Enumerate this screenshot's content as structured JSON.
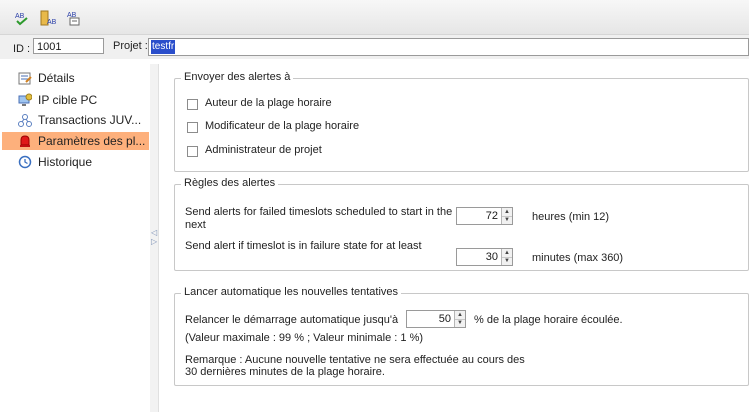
{
  "toolbar": {
    "buttons": [
      {
        "icon": "spellcheck-icon",
        "label": "AB"
      },
      {
        "icon": "rename-icon",
        "label": "AB"
      },
      {
        "icon": "paste-text-icon",
        "label": "AB"
      }
    ]
  },
  "header": {
    "id_label": "ID :",
    "id_value": "1001",
    "project_label": "Projet :",
    "project_value": "testfr"
  },
  "sidebar": {
    "items": [
      {
        "label": "Détails",
        "icon": "details-icon",
        "selected": false
      },
      {
        "label": "IP cible PC",
        "icon": "target-ip-icon",
        "selected": false
      },
      {
        "label": "Transactions JUV...",
        "icon": "transactions-icon",
        "selected": false
      },
      {
        "label": "Paramètres des pl...",
        "icon": "alert-bell-icon",
        "selected": true
      },
      {
        "label": "Historique",
        "icon": "history-icon",
        "selected": false
      }
    ]
  },
  "splitter": {
    "left_arrow": "◁",
    "right_arrow": "▷"
  },
  "alerts_to": {
    "title": "Envoyer des alertes à",
    "options": [
      {
        "label": "Auteur de la plage horaire",
        "checked": false
      },
      {
        "label": "Modificateur de la plage horaire",
        "checked": false
      },
      {
        "label": "Administrateur de projet",
        "checked": false
      }
    ]
  },
  "alert_rules": {
    "title": "Règles des alertes",
    "rule1_line1": "Send alerts for failed timeslots scheduled to start in the",
    "rule1_line2": "next",
    "rule1_value": "72",
    "rule1_unit": "heures (min 12)",
    "rule2_text": "Send alert if timeslot is in failure state for at least",
    "rule2_value": "30",
    "rule2_unit": "minutes (max 360)"
  },
  "retries": {
    "title": "Lancer automatique les nouvelles tentatives",
    "relaunch_label": "Relancer le démarrage automatique jusqu'à",
    "relaunch_value": "50",
    "relaunch_suffix": "% de la plage horaire écoulée.",
    "limits": "(Valeur maximale : 99 % ; Valeur minimale : 1 %)",
    "note_line1": "Remarque : Aucune nouvelle tentative ne sera effectuée au cours des",
    "note_line2": "30 dernières minutes de la plage horaire."
  },
  "spinner_arrows": {
    "up": "▲",
    "down": "▼"
  }
}
